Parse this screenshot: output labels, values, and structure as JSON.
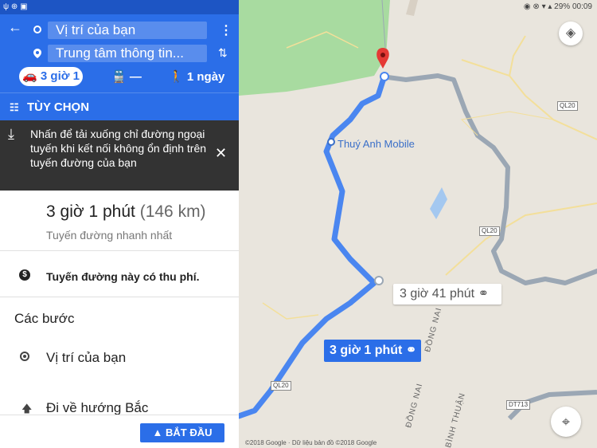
{
  "status": {
    "left_icons": "ψ ⊕ ▣",
    "time": "00:09",
    "battery": "29%",
    "right_icons": "◉ ⊗ ▾ ▴"
  },
  "directions": {
    "origin": "Vị trí của bạn",
    "destination": "Trung tâm thông tin...",
    "modes": {
      "drive": "3 giờ 1",
      "transit": "—",
      "walk": "1 ngày"
    },
    "options_label": "TÙY CHỌN",
    "banner_text": "Nhấn để tải xuống chỉ đường ngoại tuyến khi kết nối không ổn định trên tuyến đường của bạn"
  },
  "summary": {
    "time": "3 giờ 1 phút",
    "distance": "(146 km)",
    "subtitle": "Tuyến đường nhanh nhất"
  },
  "toll": {
    "text": "Tuyến đường này có thu phí."
  },
  "steps": {
    "title": "Các bước",
    "items": [
      {
        "text": "Vị trí của bạn"
      },
      {
        "text": "Đi về hướng Bắc"
      }
    ]
  },
  "start_button": "BẮT ĐẦU",
  "map": {
    "poi": "Thuý Anh Mobile",
    "alt_route_label": "3 giờ 41 phút",
    "main_route_label": "3 giờ 1 phút",
    "roads": [
      "QL20",
      "QL20",
      "QL20",
      "DT713"
    ],
    "area_labels": [
      "ĐỒNG NAI",
      "ĐỒNG NAI",
      "BÌNH THUẬN"
    ],
    "copyright": "©2018 Google · Dữ liệu bản đồ ©2018 Google",
    "route_color": "#4a86f0",
    "alt_route_color": "#9ba7b4"
  }
}
